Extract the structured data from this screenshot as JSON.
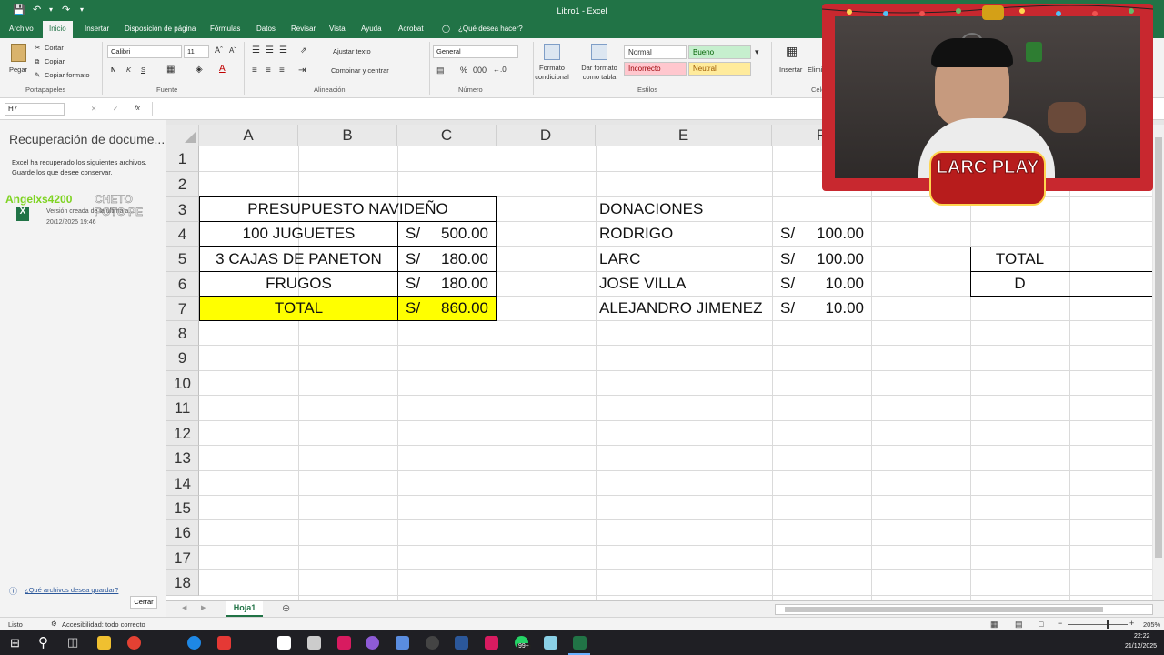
{
  "window": {
    "title": "Libro1  -  Excel"
  },
  "tabs": [
    "Archivo",
    "Inicio",
    "Insertar",
    "Disposición de página",
    "Fórmulas",
    "Datos",
    "Revisar",
    "Vista",
    "Ayuda",
    "Acrobat",
    "¿Qué desea hacer?"
  ],
  "ribbon": {
    "clipboard": {
      "paste": "Pegar",
      "cut": "Cortar",
      "copy": "Copiar",
      "format_painter": "Copiar formato",
      "label": "Portapapeles"
    },
    "font": {
      "name": "Calibri",
      "size": "11",
      "bold": "N",
      "italic": "K",
      "underline": "S",
      "label": "Fuente"
    },
    "alignment": {
      "wrap": "Ajustar texto",
      "merge": "Combinar y centrar",
      "label": "Alineación"
    },
    "number": {
      "format": "General",
      "label": "Número"
    },
    "styles": {
      "conditional": "Formato condicional",
      "as_table": "Dar formato como tabla",
      "normal": "Normal",
      "good": "Bueno",
      "bad": "Incorrecto",
      "neutral": "Neutral",
      "label": "Estilos"
    },
    "cells": {
      "insert": "Insertar",
      "delete": "Elimin",
      "label": "Celda"
    }
  },
  "formula_bar": {
    "name_box": "H7",
    "fx": "fx",
    "value": ""
  },
  "recovery": {
    "title": "Recuperación de docume...",
    "description": "Excel ha recuperado los siguientes archivos. Guarde los que desee conservar.",
    "overlay_user": "Angelxs4200",
    "overlay_msg": "CHETO POTO PE",
    "file_version": "Versión creada de la última a...",
    "file_date": "20/12/2025 19:46",
    "link": "¿Qué archivos desea guardar?",
    "close": "Cerrar"
  },
  "grid": {
    "columns": [
      "A",
      "B",
      "C",
      "D",
      "E",
      "F"
    ],
    "rows": [
      "1",
      "2",
      "3",
      "4",
      "5",
      "6",
      "7",
      "8",
      "9",
      "10",
      "11",
      "12",
      "13",
      "14",
      "15",
      "16",
      "17",
      "18"
    ],
    "budget": {
      "title": "PRESUPUESTO NAVIDEÑO",
      "items": [
        {
          "label": "100 JUGUETES",
          "currency": "S/",
          "amount": "500.00"
        },
        {
          "label": "3 CAJAS DE PANETON",
          "currency": "S/",
          "amount": "180.00"
        },
        {
          "label": "FRUGOS",
          "currency": "S/",
          "amount": "180.00"
        }
      ],
      "total": {
        "label": "TOTAL",
        "currency": "S/",
        "amount": "860.00"
      }
    },
    "donations": {
      "title": "DONACIONES",
      "items": [
        {
          "name": "RODRIGO",
          "currency": "S/",
          "amount": "100.00"
        },
        {
          "name": "LARC",
          "currency": "S/",
          "amount": "100.00"
        },
        {
          "name": "JOSE VILLA",
          "currency": "S/",
          "amount": "10.00"
        },
        {
          "name": "ALEJANDRO JIMENEZ",
          "currency": "S/",
          "amount": "10.00"
        }
      ]
    },
    "side_box": {
      "total": "TOTAL",
      "d": "D"
    }
  },
  "sheets": {
    "active": "Hoja1"
  },
  "status": {
    "ready": "Listo",
    "accessibility": "Accesibilidad: todo correcto",
    "zoom": "205%"
  },
  "taskbar": {
    "time": "22:22",
    "date": "21/12/2025",
    "badge": "99+"
  },
  "cam": {
    "logo": "LARC PLAY"
  },
  "colors": {
    "excel_green": "#217346",
    "total_fill": "#ffff00",
    "good_fill": "#c6efce",
    "bad_fill": "#ffc7ce",
    "neutral_fill": "#ffeb9c",
    "cam_frame": "#c8282f"
  }
}
